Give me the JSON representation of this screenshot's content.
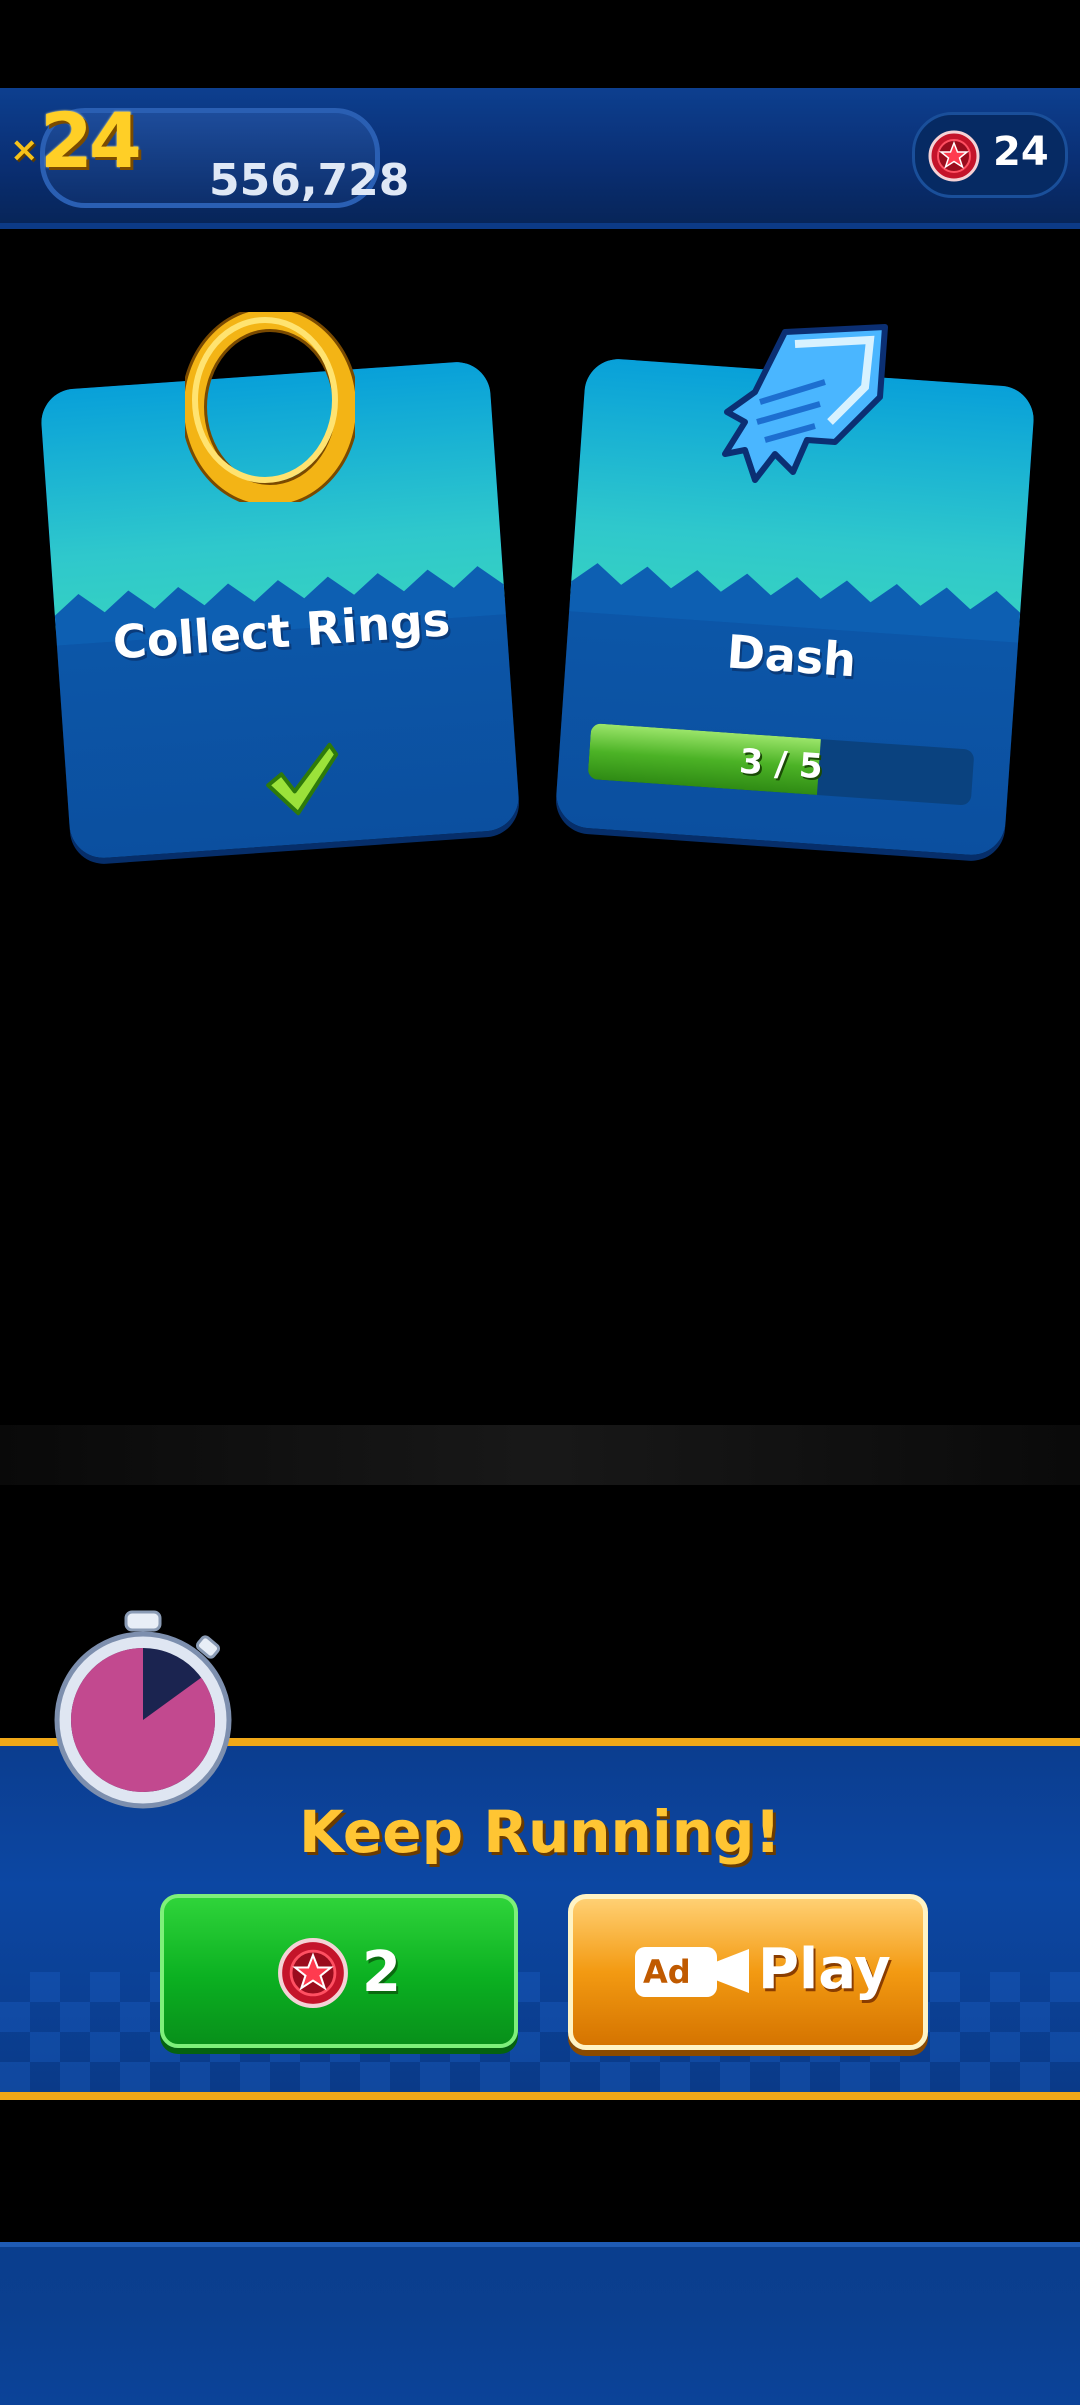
{
  "hud": {
    "multiplier_prefix": "×",
    "multiplier": "24",
    "score": "556,728",
    "red_star_rings": "24"
  },
  "missions": [
    {
      "title": "Collect Rings",
      "icon": "gold-ring-icon",
      "completed": true
    },
    {
      "title": "Dash",
      "icon": "dash-crystal-icon",
      "progress_text": "3 / 5",
      "progress_fraction": 0.6
    }
  ],
  "revive": {
    "title": "Keep Running!",
    "cost_button": {
      "amount": "2",
      "icon": "red-star-ring-icon"
    },
    "ad_button": {
      "badge": "Ad",
      "label": "Play",
      "icon": "video-camera-icon"
    },
    "timer_remaining_fraction": 0.85
  },
  "colors": {
    "accent_gold": "#f0a818",
    "green_button": "#0bb021",
    "orange_button": "#f39a12",
    "hud_blue": "#0b3f8f"
  }
}
